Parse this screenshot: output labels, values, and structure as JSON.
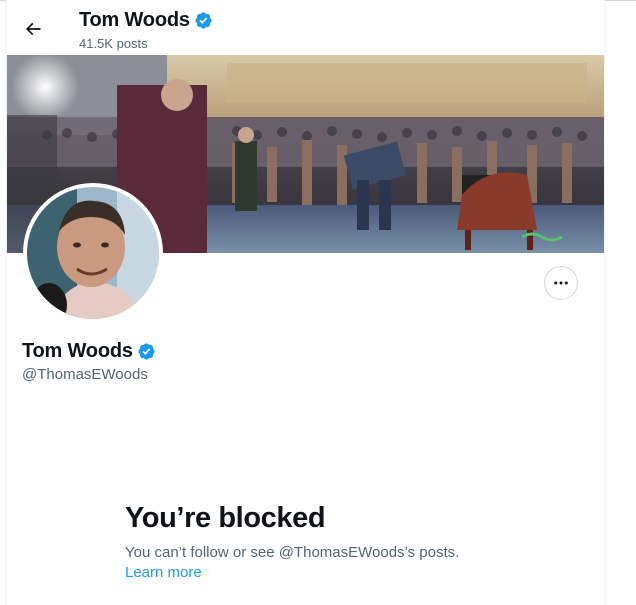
{
  "header": {
    "name": "Tom Woods",
    "posts": "41.5K posts",
    "back_icon": "arrow-left-icon",
    "verified_icon": "verified-badge-icon"
  },
  "profile": {
    "name": "Tom Woods",
    "handle": "@ThomasEWoods",
    "more_icon": "more-horizontal-icon",
    "banner_image": "conference-crowd-photo",
    "avatar_image": "profile-photo"
  },
  "blocked": {
    "title": "You’re blocked",
    "message": "You can’t follow or see @ThomasEWoods’s posts.",
    "learn_more": "Learn more"
  },
  "colors": {
    "accent": "#1d9bf0",
    "text_primary": "#0f1419",
    "text_secondary": "#536471",
    "border": "#cfd9de"
  }
}
